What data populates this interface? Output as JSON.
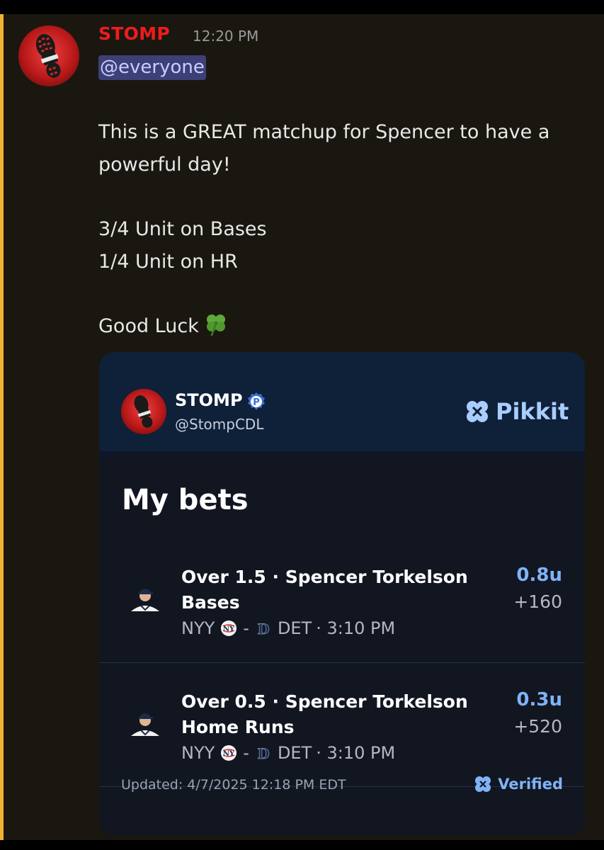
{
  "message": {
    "author": "STOMP",
    "timestamp": "12:20 PM",
    "mention": "@everyone",
    "lines": [
      "This is a GREAT matchup for Spencer to have a",
      "powerful day!",
      "3/4 Unit on Bases",
      "1/4 Unit on HR",
      "Good Luck"
    ],
    "emoji": "four-leaf-clover",
    "colors": {
      "author": "#ee1c1c",
      "mention_bg": "#3d3f77",
      "highlight_bar": "#f0b232",
      "background": "#1a1710"
    }
  },
  "card": {
    "user_name": "STOMP",
    "handle": "@StompCDL",
    "badge_letter": "P",
    "brand": "Pikkit",
    "title": "My bets",
    "bets": [
      {
        "title": "Over 1.5 · Spencer Torkelson Bases",
        "units": "0.8u",
        "odds": "+160",
        "away": "NYY",
        "separator": "-",
        "home": "DET",
        "time": "· 3:10 PM"
      },
      {
        "title": "Over 0.5 · Spencer Torkelson Home Runs",
        "units": "0.3u",
        "odds": "+520",
        "away": "NYY",
        "separator": "-",
        "home": "DET",
        "time": "· 3:10 PM"
      }
    ],
    "updated": "Updated: 4/7/2025 12:18 PM EDT",
    "verified": "Verified",
    "colors": {
      "accent": "#7fb3f6",
      "header_bg": "#0f2039",
      "body_bg": "#111621"
    }
  }
}
